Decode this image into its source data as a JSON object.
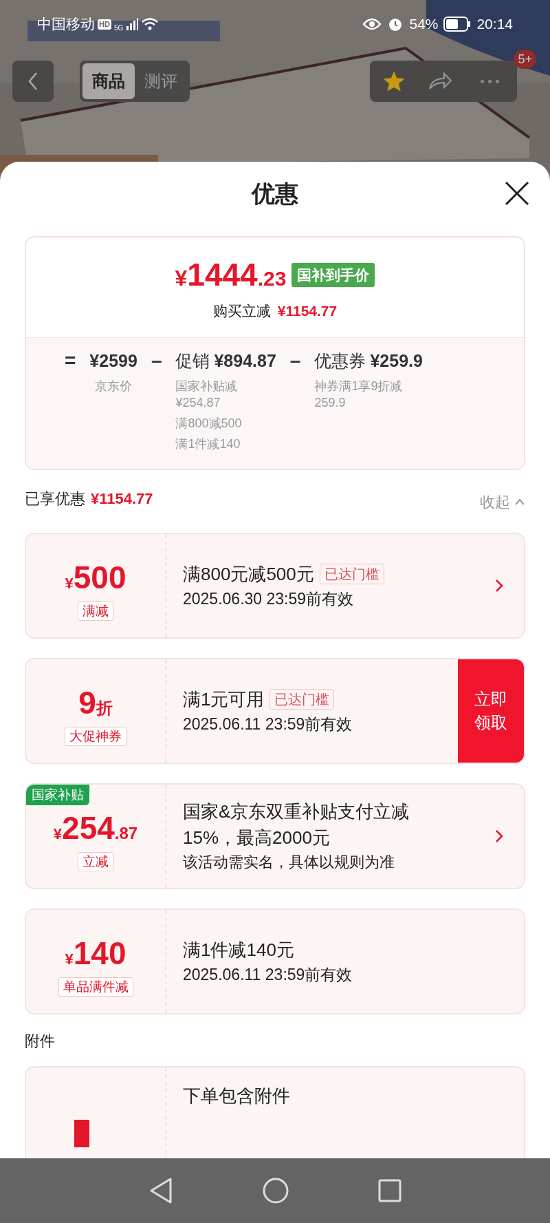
{
  "status_bar": {
    "carrier": "中国移动",
    "hd": "HD",
    "network": "5G",
    "battery": "54%",
    "time": "20:14"
  },
  "nav": {
    "tabs": [
      {
        "label": "商品",
        "selected": true
      },
      {
        "label": "测评",
        "selected": false
      }
    ],
    "badge": "5+"
  },
  "sheet": {
    "title": "优惠"
  },
  "summary": {
    "symbol": "¥",
    "price": "1444",
    "decimal": ".23",
    "tag": "国补到手价",
    "reduce_label": "购买立减",
    "reduce_value": "¥1154.77",
    "breakdown": [
      {
        "op": "=",
        "amount": "¥2599",
        "notes": [
          "京东价"
        ]
      },
      {
        "op": "–",
        "label": "促销",
        "amount": "¥894.87",
        "notes": [
          "国家补贴减¥254.87",
          "满800减500",
          "满1件减140"
        ]
      },
      {
        "op": "–",
        "label": "优惠券",
        "amount": "¥259.9",
        "notes": [
          "神券满1享9折减259.9"
        ]
      }
    ]
  },
  "applied": {
    "label": "已享优惠",
    "value": "¥1154.77",
    "toggle": "收起",
    "expanded": true
  },
  "coupons": [
    {
      "kind": "amount",
      "symbol": "¥",
      "amount": "500",
      "tag": "满减",
      "title": "满800元减500元",
      "threshold": "已达门槛",
      "subtitle": "2025.06.30 23:59前有效",
      "chevron": true
    },
    {
      "kind": "discount",
      "amount": "9",
      "unit": "折",
      "tag": "大促神券",
      "title": "满1元可用",
      "threshold": "已达门槛",
      "subtitle": "2025.06.11 23:59前有效",
      "chevron": false,
      "action": "立即领取"
    },
    {
      "kind": "amount",
      "symbol": "¥",
      "amount": "254",
      "decimal": ".87",
      "tag": "立减",
      "corner_badge": "国家补贴",
      "title": "国家&京东双重补贴支付立减15%，最高2000元",
      "subtitle": "该活动需实名，具体以规则为准",
      "chevron": true
    },
    {
      "kind": "amount",
      "symbol": "¥",
      "amount": "140",
      "tag": "单品满件减",
      "title": "满1件减140元",
      "subtitle": "2025.06.11 23:59前有效",
      "chevron": false
    }
  ],
  "attachments": {
    "heading": "附件",
    "item_title": "下单包含附件"
  }
}
